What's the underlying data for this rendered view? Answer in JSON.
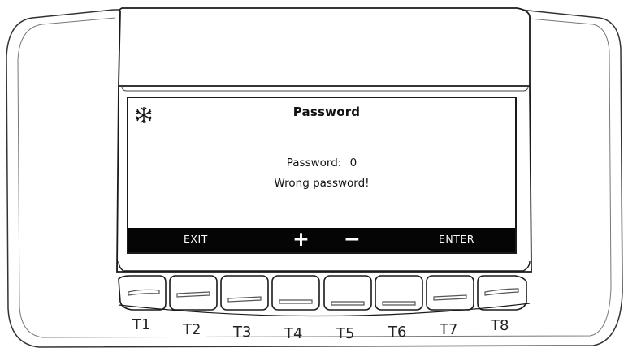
{
  "screen": {
    "title": "Password",
    "password_label": "Password:",
    "password_value": "0",
    "message": "Wrong password!",
    "status_icon": "snowflake-icon"
  },
  "softkeys": {
    "exit_label": "EXIT",
    "plus_label": "+",
    "minus_label": "−",
    "enter_label": "ENTER"
  },
  "keys": [
    {
      "label": "T1"
    },
    {
      "label": "T2"
    },
    {
      "label": "T3"
    },
    {
      "label": "T4"
    },
    {
      "label": "T5"
    },
    {
      "label": "T6"
    },
    {
      "label": "T7"
    },
    {
      "label": "T8"
    }
  ],
  "colors": {
    "outline": "#1a1a1a",
    "softkey_bar": "#050505",
    "screen_bg": "#ffffff"
  }
}
